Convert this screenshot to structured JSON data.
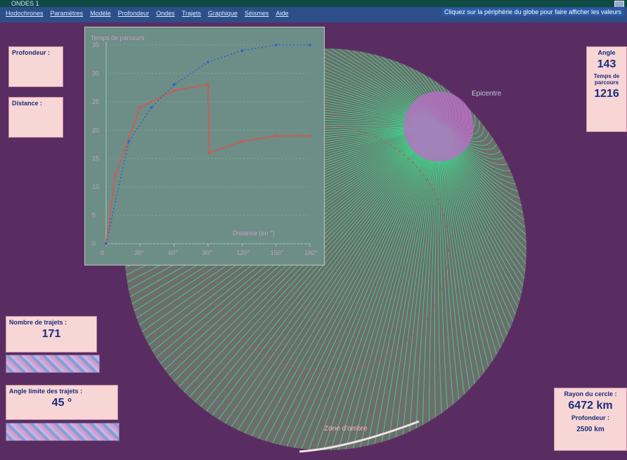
{
  "window": {
    "title": "ONDES 1"
  },
  "menu": {
    "items": [
      "Hodochrones",
      "Paramètres",
      "Modèle",
      "Profondeur",
      "Ondes",
      "Trajets",
      "Graphique",
      "Séismes",
      "Aide"
    ],
    "hint": "Cliquez sur la périphérie du globe pour faire afficher les valeurs"
  },
  "left_panels": {
    "profondeur_label": "Profondeur :",
    "distance_label": "Distance :"
  },
  "right_panel": {
    "angle_label": "Angle",
    "angle_value": "143",
    "time_label": "Temps de parcours",
    "time_value": "1216"
  },
  "rays_panel": {
    "label": "Nombre de trajets :",
    "value": "171"
  },
  "angle_panel": {
    "label": "Angle limite des trajets :",
    "value": "45 °"
  },
  "radius_panel": {
    "label": "Rayon du cercle :",
    "value": "6472 km",
    "depth_label": "Profondeur :",
    "depth_value": "2500 km"
  },
  "globe": {
    "label_top": "Epicentre",
    "label_bottom": "Zone d'ombre",
    "colors": {
      "disk": "#6d6d6d",
      "ray": "#44d08a",
      "focus": "#c06ac9"
    }
  },
  "chart_data": {
    "type": "line",
    "title": "Temps de parcours",
    "xlabel": "Distance (en °)",
    "x_ticks": [
      "0",
      "30°",
      "60°",
      "90°",
      "120°",
      "150°",
      "180°"
    ],
    "y_ticks": [
      "0",
      "5",
      "10",
      "15",
      "20",
      "25",
      "30",
      "35"
    ],
    "ylim": [
      0,
      35
    ],
    "xlim": [
      0,
      180
    ],
    "series": [
      {
        "color": "#e05050",
        "points": [
          [
            0,
            0
          ],
          [
            8,
            12
          ],
          [
            30,
            24
          ],
          [
            60,
            27
          ],
          [
            90,
            28
          ],
          [
            91,
            16
          ],
          [
            120,
            18
          ],
          [
            150,
            19
          ],
          [
            180,
            19
          ]
        ]
      },
      {
        "color": "#3060d0",
        "points": [
          [
            0,
            0
          ],
          [
            20,
            18
          ],
          [
            40,
            24
          ],
          [
            60,
            28
          ],
          [
            90,
            32
          ],
          [
            120,
            34
          ],
          [
            150,
            35
          ],
          [
            180,
            35
          ]
        ]
      }
    ]
  }
}
